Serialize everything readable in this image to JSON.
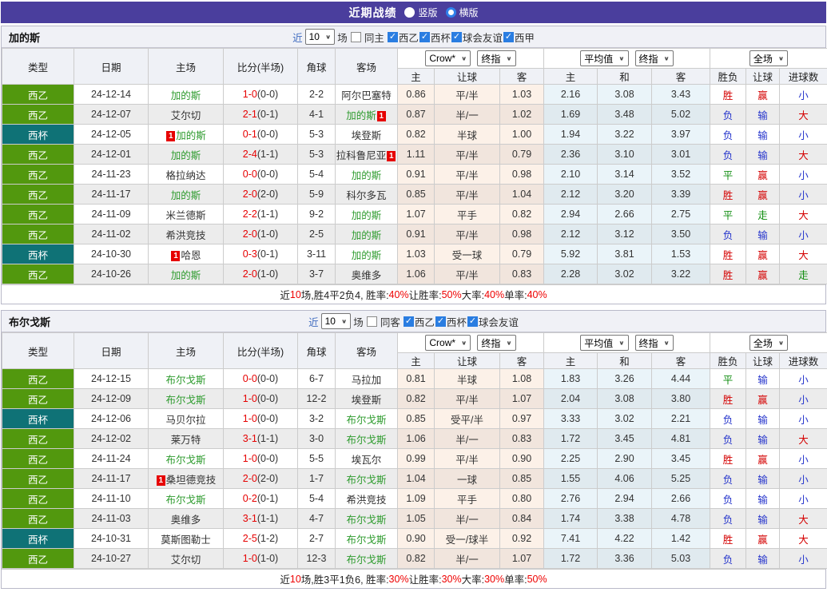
{
  "topbar": {
    "title": "近期战绩",
    "view_options": [
      {
        "label": "竖版",
        "selected": false
      },
      {
        "label": "横版",
        "selected": true
      }
    ]
  },
  "colors": {
    "accent_purple": "#4a3e9d",
    "league_green": "#52980e",
    "league_cup_teal": "#0f7276",
    "focus_team_green": "#2e9b2e",
    "score_red": "#e60000",
    "win_red": "#d40000",
    "lose_blue": "#2635cc",
    "draw_green": "#0d8c0d",
    "checkbox_blue": "#2a7de1"
  },
  "header": {
    "columns": {
      "type": "类型",
      "date": "日期",
      "home": "主场",
      "score": "比分(半场)",
      "corner": "角球",
      "away": "客场"
    },
    "selects": {
      "bookmaker": "Crow*",
      "final1": "终指",
      "average": "平均值",
      "final2": "终指",
      "full": "全场"
    },
    "subcols": {
      "crow_home": "主",
      "crow_handicap": "让球",
      "crow_away": "客",
      "avg_home": "主",
      "avg_draw": "和",
      "avg_away": "客",
      "res_wdl": "胜负",
      "res_handicap": "让球",
      "res_goals": "进球数"
    }
  },
  "sections": [
    {
      "team": "加的斯",
      "filter": {
        "near_label": "近",
        "count": "10",
        "games_label": "场",
        "same_checked": false,
        "same_label": "同主",
        "leagues": [
          {
            "label": "西乙",
            "checked": true
          },
          {
            "label": "西杯",
            "checked": true
          },
          {
            "label": "球会友谊",
            "checked": true
          },
          {
            "label": "西甲",
            "checked": true
          }
        ]
      },
      "rows": [
        {
          "league": "西乙",
          "league_color": "green",
          "date": "24-12-14",
          "home": "加的斯",
          "home_focus": true,
          "home_badge": "",
          "score": "1-0",
          "half": "(0-0)",
          "corner": "2-2",
          "away": "阿尔巴塞特",
          "away_focus": false,
          "away_badge": "",
          "crow_home": "0.86",
          "crow_line": "平/半",
          "crow_away": "1.03",
          "avg_home": "2.16",
          "avg_draw": "3.08",
          "avg_away": "3.43",
          "res_wdl": "胜",
          "res_wdl_color": "r",
          "res_let": "赢",
          "res_let_color": "r",
          "res_goal": "小",
          "res_goal_color": "b"
        },
        {
          "league": "西乙",
          "league_color": "green",
          "date": "24-12-07",
          "home": "艾尔切",
          "home_focus": false,
          "home_badge": "",
          "score": "2-1",
          "half": "(0-1)",
          "corner": "4-1",
          "away": "加的斯",
          "away_focus": true,
          "away_badge": "1",
          "crow_home": "0.87",
          "crow_line": "半/一",
          "crow_away": "1.02",
          "avg_home": "1.69",
          "avg_draw": "3.48",
          "avg_away": "5.02",
          "res_wdl": "负",
          "res_wdl_color": "b",
          "res_let": "输",
          "res_let_color": "b",
          "res_goal": "大",
          "res_goal_color": "r"
        },
        {
          "league": "西杯",
          "league_color": "teal",
          "date": "24-12-05",
          "home": "加的斯",
          "home_focus": true,
          "home_badge": "1",
          "score": "0-1",
          "half": "(0-0)",
          "corner": "5-3",
          "away": "埃登斯",
          "away_focus": false,
          "away_badge": "",
          "crow_home": "0.82",
          "crow_line": "半球",
          "crow_away": "1.00",
          "avg_home": "1.94",
          "avg_draw": "3.22",
          "avg_away": "3.97",
          "res_wdl": "负",
          "res_wdl_color": "b",
          "res_let": "输",
          "res_let_color": "b",
          "res_goal": "小",
          "res_goal_color": "b"
        },
        {
          "league": "西乙",
          "league_color": "green",
          "date": "24-12-01",
          "home": "加的斯",
          "home_focus": true,
          "home_badge": "",
          "score": "2-4",
          "half": "(1-1)",
          "corner": "5-3",
          "away": "拉科鲁尼亚",
          "away_focus": false,
          "away_badge": "1",
          "crow_home": "1.11",
          "crow_line": "平/半",
          "crow_away": "0.79",
          "avg_home": "2.36",
          "avg_draw": "3.10",
          "avg_away": "3.01",
          "res_wdl": "负",
          "res_wdl_color": "b",
          "res_let": "输",
          "res_let_color": "b",
          "res_goal": "大",
          "res_goal_color": "r"
        },
        {
          "league": "西乙",
          "league_color": "green",
          "date": "24-11-23",
          "home": "格拉纳达",
          "home_focus": false,
          "home_badge": "",
          "score": "0-0",
          "half": "(0-0)",
          "corner": "5-4",
          "away": "加的斯",
          "away_focus": true,
          "away_badge": "",
          "crow_home": "0.91",
          "crow_line": "平/半",
          "crow_away": "0.98",
          "avg_home": "2.10",
          "avg_draw": "3.14",
          "avg_away": "3.52",
          "res_wdl": "平",
          "res_wdl_color": "g",
          "res_let": "赢",
          "res_let_color": "r",
          "res_goal": "小",
          "res_goal_color": "b"
        },
        {
          "league": "西乙",
          "league_color": "green",
          "date": "24-11-17",
          "home": "加的斯",
          "home_focus": true,
          "home_badge": "",
          "score": "2-0",
          "half": "(2-0)",
          "corner": "5-9",
          "away": "科尔多瓦",
          "away_focus": false,
          "away_badge": "",
          "crow_home": "0.85",
          "crow_line": "平/半",
          "crow_away": "1.04",
          "avg_home": "2.12",
          "avg_draw": "3.20",
          "avg_away": "3.39",
          "res_wdl": "胜",
          "res_wdl_color": "r",
          "res_let": "赢",
          "res_let_color": "r",
          "res_goal": "小",
          "res_goal_color": "b"
        },
        {
          "league": "西乙",
          "league_color": "green",
          "date": "24-11-09",
          "home": "米兰德斯",
          "home_focus": false,
          "home_badge": "",
          "score": "2-2",
          "half": "(1-1)",
          "corner": "9-2",
          "away": "加的斯",
          "away_focus": true,
          "away_badge": "",
          "crow_home": "1.07",
          "crow_line": "平手",
          "crow_away": "0.82",
          "avg_home": "2.94",
          "avg_draw": "2.66",
          "avg_away": "2.75",
          "res_wdl": "平",
          "res_wdl_color": "g",
          "res_let": "走",
          "res_let_color": "g",
          "res_goal": "大",
          "res_goal_color": "r"
        },
        {
          "league": "西乙",
          "league_color": "green",
          "date": "24-11-02",
          "home": "希洪竞技",
          "home_focus": false,
          "home_badge": "",
          "score": "2-0",
          "half": "(1-0)",
          "corner": "2-5",
          "away": "加的斯",
          "away_focus": true,
          "away_badge": "",
          "crow_home": "0.91",
          "crow_line": "平/半",
          "crow_away": "0.98",
          "avg_home": "2.12",
          "avg_draw": "3.12",
          "avg_away": "3.50",
          "res_wdl": "负",
          "res_wdl_color": "b",
          "res_let": "输",
          "res_let_color": "b",
          "res_goal": "小",
          "res_goal_color": "b"
        },
        {
          "league": "西杯",
          "league_color": "teal",
          "date": "24-10-30",
          "home": "哈恩",
          "home_focus": false,
          "home_badge": "1",
          "score": "0-3",
          "half": "(0-1)",
          "corner": "3-11",
          "away": "加的斯",
          "away_focus": true,
          "away_badge": "",
          "crow_home": "1.03",
          "crow_line": "受一球",
          "crow_away": "0.79",
          "avg_home": "5.92",
          "avg_draw": "3.81",
          "avg_away": "1.53",
          "res_wdl": "胜",
          "res_wdl_color": "r",
          "res_let": "赢",
          "res_let_color": "r",
          "res_goal": "大",
          "res_goal_color": "r"
        },
        {
          "league": "西乙",
          "league_color": "green",
          "date": "24-10-26",
          "home": "加的斯",
          "home_focus": true,
          "home_badge": "",
          "score": "2-0",
          "half": "(1-0)",
          "corner": "3-7",
          "away": "奥维多",
          "away_focus": false,
          "away_badge": "",
          "crow_home": "1.06",
          "crow_line": "平/半",
          "crow_away": "0.83",
          "avg_home": "2.28",
          "avg_draw": "3.02",
          "avg_away": "3.22",
          "res_wdl": "胜",
          "res_wdl_color": "r",
          "res_let": "赢",
          "res_let_color": "r",
          "res_goal": "走",
          "res_goal_color": "g"
        }
      ],
      "summary": [
        {
          "text": "近",
          "red": false
        },
        {
          "text": "10",
          "red": true
        },
        {
          "text": "场,胜4平2负4, 胜率:",
          "red": false
        },
        {
          "text": "40%",
          "red": true
        },
        {
          "text": " 让胜率:",
          "red": false
        },
        {
          "text": "50%",
          "red": true
        },
        {
          "text": " 大率:",
          "red": false
        },
        {
          "text": "40%",
          "red": true
        },
        {
          "text": " 单率:",
          "red": false
        },
        {
          "text": "40%",
          "red": true
        }
      ]
    },
    {
      "team": "布尔戈斯",
      "filter": {
        "near_label": "近",
        "count": "10",
        "games_label": "场",
        "same_checked": false,
        "same_label": "同客",
        "leagues": [
          {
            "label": "西乙",
            "checked": true
          },
          {
            "label": "西杯",
            "checked": true
          },
          {
            "label": "球会友谊",
            "checked": true
          }
        ]
      },
      "rows": [
        {
          "league": "西乙",
          "league_color": "green",
          "date": "24-12-15",
          "home": "布尔戈斯",
          "home_focus": true,
          "home_badge": "",
          "score": "0-0",
          "half": "(0-0)",
          "corner": "6-7",
          "away": "马拉加",
          "away_focus": false,
          "away_badge": "",
          "crow_home": "0.81",
          "crow_line": "半球",
          "crow_away": "1.08",
          "avg_home": "1.83",
          "avg_draw": "3.26",
          "avg_away": "4.44",
          "res_wdl": "平",
          "res_wdl_color": "g",
          "res_let": "输",
          "res_let_color": "b",
          "res_goal": "小",
          "res_goal_color": "b"
        },
        {
          "league": "西乙",
          "league_color": "green",
          "date": "24-12-09",
          "home": "布尔戈斯",
          "home_focus": true,
          "home_badge": "",
          "score": "1-0",
          "half": "(0-0)",
          "corner": "12-2",
          "away": "埃登斯",
          "away_focus": false,
          "away_badge": "",
          "crow_home": "0.82",
          "crow_line": "平/半",
          "crow_away": "1.07",
          "avg_home": "2.04",
          "avg_draw": "3.08",
          "avg_away": "3.80",
          "res_wdl": "胜",
          "res_wdl_color": "r",
          "res_let": "赢",
          "res_let_color": "r",
          "res_goal": "小",
          "res_goal_color": "b"
        },
        {
          "league": "西杯",
          "league_color": "teal",
          "date": "24-12-06",
          "home": "马贝尔拉",
          "home_focus": false,
          "home_badge": "",
          "score": "1-0",
          "half": "(0-0)",
          "corner": "3-2",
          "away": "布尔戈斯",
          "away_focus": true,
          "away_badge": "",
          "crow_home": "0.85",
          "crow_line": "受平/半",
          "crow_away": "0.97",
          "avg_home": "3.33",
          "avg_draw": "3.02",
          "avg_away": "2.21",
          "res_wdl": "负",
          "res_wdl_color": "b",
          "res_let": "输",
          "res_let_color": "b",
          "res_goal": "小",
          "res_goal_color": "b"
        },
        {
          "league": "西乙",
          "league_color": "green",
          "date": "24-12-02",
          "home": "莱万特",
          "home_focus": false,
          "home_badge": "",
          "score": "3-1",
          "half": "(1-1)",
          "corner": "3-0",
          "away": "布尔戈斯",
          "away_focus": true,
          "away_badge": "",
          "crow_home": "1.06",
          "crow_line": "半/一",
          "crow_away": "0.83",
          "avg_home": "1.72",
          "avg_draw": "3.45",
          "avg_away": "4.81",
          "res_wdl": "负",
          "res_wdl_color": "b",
          "res_let": "输",
          "res_let_color": "b",
          "res_goal": "大",
          "res_goal_color": "r"
        },
        {
          "league": "西乙",
          "league_color": "green",
          "date": "24-11-24",
          "home": "布尔戈斯",
          "home_focus": true,
          "home_badge": "",
          "score": "1-0",
          "half": "(0-0)",
          "corner": "5-5",
          "away": "埃瓦尔",
          "away_focus": false,
          "away_badge": "",
          "crow_home": "0.99",
          "crow_line": "平/半",
          "crow_away": "0.90",
          "avg_home": "2.25",
          "avg_draw": "2.90",
          "avg_away": "3.45",
          "res_wdl": "胜",
          "res_wdl_color": "r",
          "res_let": "赢",
          "res_let_color": "r",
          "res_goal": "小",
          "res_goal_color": "b"
        },
        {
          "league": "西乙",
          "league_color": "green",
          "date": "24-11-17",
          "home": "桑坦德竞技",
          "home_focus": false,
          "home_badge": "1",
          "score": "2-0",
          "half": "(2-0)",
          "corner": "1-7",
          "away": "布尔戈斯",
          "away_focus": true,
          "away_badge": "",
          "crow_home": "1.04",
          "crow_line": "一球",
          "crow_away": "0.85",
          "avg_home": "1.55",
          "avg_draw": "4.06",
          "avg_away": "5.25",
          "res_wdl": "负",
          "res_wdl_color": "b",
          "res_let": "输",
          "res_let_color": "b",
          "res_goal": "小",
          "res_goal_color": "b"
        },
        {
          "league": "西乙",
          "league_color": "green",
          "date": "24-11-10",
          "home": "布尔戈斯",
          "home_focus": true,
          "home_badge": "",
          "score": "0-2",
          "half": "(0-1)",
          "corner": "5-4",
          "away": "希洪竞技",
          "away_focus": false,
          "away_badge": "",
          "crow_home": "1.09",
          "crow_line": "平手",
          "crow_away": "0.80",
          "avg_home": "2.76",
          "avg_draw": "2.94",
          "avg_away": "2.66",
          "res_wdl": "负",
          "res_wdl_color": "b",
          "res_let": "输",
          "res_let_color": "b",
          "res_goal": "小",
          "res_goal_color": "b"
        },
        {
          "league": "西乙",
          "league_color": "green",
          "date": "24-11-03",
          "home": "奥维多",
          "home_focus": false,
          "home_badge": "",
          "score": "3-1",
          "half": "(1-1)",
          "corner": "4-7",
          "away": "布尔戈斯",
          "away_focus": true,
          "away_badge": "",
          "crow_home": "1.05",
          "crow_line": "半/一",
          "crow_away": "0.84",
          "avg_home": "1.74",
          "avg_draw": "3.38",
          "avg_away": "4.78",
          "res_wdl": "负",
          "res_wdl_color": "b",
          "res_let": "输",
          "res_let_color": "b",
          "res_goal": "大",
          "res_goal_color": "r"
        },
        {
          "league": "西杯",
          "league_color": "teal",
          "date": "24-10-31",
          "home": "莫斯图勒士",
          "home_focus": false,
          "home_badge": "",
          "score": "2-5",
          "half": "(1-2)",
          "corner": "2-7",
          "away": "布尔戈斯",
          "away_focus": true,
          "away_badge": "",
          "crow_home": "0.90",
          "crow_line": "受一/球半",
          "crow_away": "0.92",
          "avg_home": "7.41",
          "avg_draw": "4.22",
          "avg_away": "1.42",
          "res_wdl": "胜",
          "res_wdl_color": "r",
          "res_let": "赢",
          "res_let_color": "r",
          "res_goal": "大",
          "res_goal_color": "r"
        },
        {
          "league": "西乙",
          "league_color": "green",
          "date": "24-10-27",
          "home": "艾尔切",
          "home_focus": false,
          "home_badge": "",
          "score": "1-0",
          "half": "(1-0)",
          "corner": "12-3",
          "away": "布尔戈斯",
          "away_focus": true,
          "away_badge": "",
          "crow_home": "0.82",
          "crow_line": "半/一",
          "crow_away": "1.07",
          "avg_home": "1.72",
          "avg_draw": "3.36",
          "avg_away": "5.03",
          "res_wdl": "负",
          "res_wdl_color": "b",
          "res_let": "输",
          "res_let_color": "b",
          "res_goal": "小",
          "res_goal_color": "b"
        }
      ],
      "summary": [
        {
          "text": "近",
          "red": false
        },
        {
          "text": "10",
          "red": true
        },
        {
          "text": "场,胜3平1负6, 胜率:",
          "red": false
        },
        {
          "text": "30%",
          "red": true
        },
        {
          "text": " 让胜率:",
          "red": false
        },
        {
          "text": "30%",
          "red": true
        },
        {
          "text": " 大率:",
          "red": false
        },
        {
          "text": "30%",
          "red": true
        },
        {
          "text": " 单率:",
          "red": false
        },
        {
          "text": "50%",
          "red": true
        }
      ]
    }
  ]
}
